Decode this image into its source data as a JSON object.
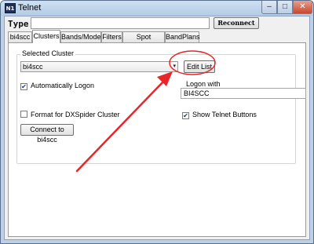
{
  "window": {
    "icon_text": "N1",
    "title": "Telnet",
    "min_glyph": "–",
    "max_glyph": "□",
    "close_glyph": "✕"
  },
  "command": {
    "label": "Type:",
    "value": "",
    "reconnect_label": "Reconnect"
  },
  "tabs": [
    {
      "label": "bi4scc"
    },
    {
      "label": "Clusters"
    },
    {
      "label": "Bands/Modes"
    },
    {
      "label": "Filters"
    },
    {
      "label": "Spot Comment"
    },
    {
      "label": "BandPlans"
    }
  ],
  "clusters": {
    "group_label": "Selected Cluster",
    "selected_cluster": "bi4scc",
    "edit_list_label": "Edit List",
    "auto_logon": {
      "label": "Automatically Logon",
      "checked": true
    },
    "logon_with_label": "Logon with",
    "logon_with_value": "BI4SCC",
    "dxspider_format": {
      "label": "Format for DXSpider Cluster",
      "checked": false
    },
    "show_telnet_buttons": {
      "label": "Show Telnet Buttons",
      "checked": true
    },
    "connect_label": "Connect to bi4scc"
  },
  "colors": {
    "annotation_red": "#e8262a",
    "checkmark": "#1f3b73"
  },
  "icons": {
    "dropdown": "▾",
    "check": "✔"
  }
}
